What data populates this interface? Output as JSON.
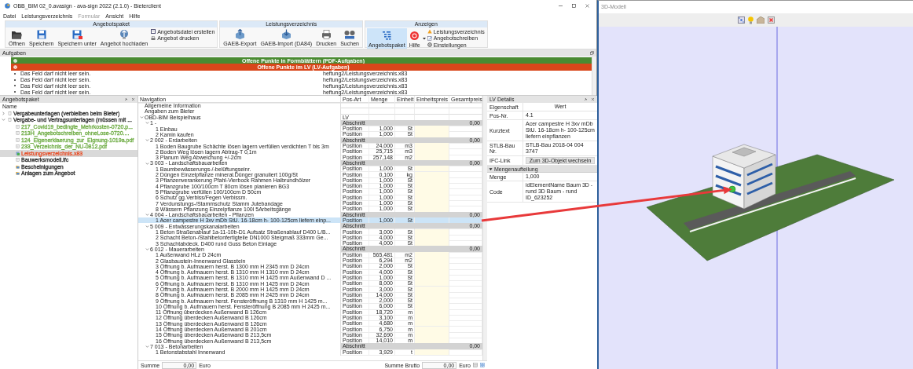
{
  "window": {
    "title": "OBB_BIM 02_0.avasign - ava-sign 2022 (2.1.0) - Bieterclient"
  },
  "menu": [
    {
      "label": "Datei",
      "disabled": false
    },
    {
      "label": "Leistungsverzeichnis",
      "disabled": false
    },
    {
      "label": "Formular",
      "disabled": true
    },
    {
      "label": "Ansicht",
      "disabled": false
    },
    {
      "label": "Hilfe",
      "disabled": false
    }
  ],
  "ribbon": [
    {
      "title": "Angebotspaket",
      "buttons": [
        {
          "label": "Öffnen",
          "kind": "large",
          "selected": false
        },
        {
          "label": "Speichern",
          "kind": "large",
          "selected": false
        },
        {
          "label": "Speichern unter",
          "kind": "large",
          "selected": false
        },
        {
          "label": "Angebot hochladen",
          "kind": "large",
          "selected": false
        },
        {
          "label": "Angebotsdatei erstellen",
          "kind": "small",
          "selected": false
        },
        {
          "label": "Angebot drucken",
          "kind": "small",
          "selected": false
        }
      ]
    },
    {
      "title": "Leistungsverzeichnis",
      "buttons": [
        {
          "label": "GAEB-Export",
          "kind": "large",
          "selected": false
        },
        {
          "label": "GAEB-Import (DA84)",
          "kind": "large",
          "selected": false
        },
        {
          "label": "Drucken",
          "kind": "large",
          "selected": false
        },
        {
          "label": "Suchen",
          "kind": "large",
          "selected": false
        }
      ]
    },
    {
      "title": "Anzeigen",
      "buttons": [
        {
          "label": "Angebotspaket",
          "kind": "large",
          "selected": true
        },
        {
          "label": "Hilfe",
          "kind": "large",
          "selected": false
        },
        {
          "label": "Leistungsverzeichnis",
          "kind": "small",
          "selected": false
        },
        {
          "label": "Angebotschreiben",
          "kind": "small",
          "selected": false
        },
        {
          "label": "Einstellungen",
          "kind": "small",
          "selected": false
        }
      ]
    }
  ],
  "tasks": {
    "title": "Aufgaben",
    "groups": [
      {
        "label": "Offene Punkte in Formblättern (PDF-Aufgaben)",
        "kind": "ok"
      },
      {
        "label": "Offene Punkte im LV (LV-Aufgaben)",
        "kind": "error"
      }
    ],
    "rows": [
      {
        "message": "Das Feld darf nicht leer sein.",
        "file": "heftung2/Leistungsverzeichnis.x83"
      },
      {
        "message": "Das Feld darf nicht leer sein.",
        "file": "heftung2/Leistungsverzeichnis.x83"
      },
      {
        "message": "Das Feld darf nicht leer sein.",
        "file": "heftung2/Leistungsverzeichnis.x83"
      },
      {
        "message": "Das Feld darf nicht leer sein.",
        "file": "heftung2/Leistungsverzeichnis.x83"
      }
    ]
  },
  "package": {
    "title": "Angebotspaket",
    "column": "Name",
    "items": [
      {
        "label": "Vergabeunterlagen (verbleiben beim Bieter)",
        "kind": "group",
        "color": "#333333",
        "selected": false,
        "expanded": false
      },
      {
        "label": "Vergabe- und Vertragsunterlagen (müssen mit ...",
        "kind": "group",
        "color": "#333333",
        "selected": false,
        "expanded": true,
        "children": [
          {
            "label": "217_Covid19_bedingte_Mehrkosten-0720.p...",
            "kind": "file",
            "color": "#70ad47",
            "selected": false
          },
          {
            "label": "213H_Angebotschreiben_ohneLose-0720....",
            "kind": "file",
            "color": "#70ad47",
            "selected": false
          },
          {
            "label": "124_Eigenerklaerung_zur_Eignung-1019a.pdf",
            "kind": "file",
            "color": "#70ad47",
            "selected": false
          },
          {
            "label": "233_Verzeichnis_der_NU-0812.pdf",
            "kind": "file",
            "color": "#70ad47",
            "selected": false
          },
          {
            "label": "Leistungsverzeichnis.x83",
            "kind": "lv",
            "color": "#e8502a",
            "selected": true
          },
          {
            "label": "Bauwerksmodell.ifc",
            "kind": "file",
            "color": "#333333",
            "selected": false
          },
          {
            "label": "Bescheinigungen",
            "kind": "folder",
            "color": "#333333",
            "selected": false
          },
          {
            "label": "Anlagen zum Angebot",
            "kind": "folder",
            "color": "#333333",
            "selected": false
          }
        ]
      }
    ]
  },
  "table": {
    "columns": [
      "Navigation",
      "Pos-Art",
      "Menge",
      "Einheit",
      "Einheitspreis",
      "Gesamtpreis"
    ],
    "rows": [
      {
        "label": "Allgemeine Information",
        "kind": "info",
        "selected": false
      },
      {
        "label": "Angaben zum Bieter",
        "kind": "info",
        "selected": false
      },
      {
        "label": "OBD-BIM Beispielhaus",
        "kind": "lv",
        "pos_art": "LV",
        "selected": false,
        "expanded": true,
        "children": [
          {
            "label": "1 -",
            "kind": "section",
            "pos_art": "Abschnitt",
            "total": "0,00",
            "selected": false,
            "expanded": true,
            "children": [
              {
                "label": "1 Einbau",
                "kind": "position",
                "pos_art": "Position",
                "menge": "1,000",
                "einheit": "St",
                "selected": false
              },
              {
                "label": "2 Kamin kaufen",
                "kind": "position",
                "pos_art": "Position",
                "menge": "1,000",
                "einheit": "St",
                "selected": false
              }
            ]
          },
          {
            "label": "2 002 - Erdarbeiten",
            "kind": "section",
            "pos_art": "Abschnitt",
            "total": "0,00",
            "selected": false,
            "expanded": true,
            "children": [
              {
                "label": "1 Boden Baugrube Schächte lösen lagern verfüllen verdichten T bis 3m",
                "kind": "position",
                "pos_art": "Position",
                "menge": "24,000",
                "einheit": "m3",
                "selected": false
              },
              {
                "label": "2 Boden Weg lösen lagern Abtrag-T 0,1m",
                "kind": "position",
                "pos_art": "Position",
                "menge": "25,715",
                "einheit": "m3",
                "selected": false
              },
              {
                "label": "3 Planum Weg Abweichung +/-2cm",
                "kind": "position",
                "pos_art": "Position",
                "menge": "257,148",
                "einheit": "m2",
                "selected": false
              }
            ]
          },
          {
            "label": "3 003 - Landschaftsbauarbeiten",
            "kind": "section",
            "pos_art": "Abschnitt",
            "total": "0,00",
            "selected": false,
            "expanded": true,
            "children": [
              {
                "label": "1 Baumbewässerungs-/-belüftungseinr.",
                "kind": "position",
                "pos_art": "Position",
                "menge": "1,000",
                "einheit": "St",
                "selected": false
              },
              {
                "label": "2 Düngen Einzelpflanze mineral.Dünger granuliert 100g/St",
                "kind": "position",
                "pos_art": "Position",
                "menge": "0,100",
                "einheit": "kg",
                "selected": false
              },
              {
                "label": "3 Pflanzenverankerung Pfahl-Vierbock Rahmen Halbrundhölzer",
                "kind": "position",
                "pos_art": "Position",
                "menge": "1,000",
                "einheit": "St",
                "selected": false
              },
              {
                "label": "4 Pflanzgrube 100/100cm T 80cm lösen planieren BG3",
                "kind": "position",
                "pos_art": "Position",
                "menge": "1,000",
                "einheit": "St",
                "selected": false
              },
              {
                "label": "5 Pflanzgrube verfüllen 100/100cm D 50cm",
                "kind": "position",
                "pos_art": "Position",
                "menge": "1,000",
                "einheit": "St",
                "selected": false
              },
              {
                "label": "6 Schutz gg.Verbiss/Fegen Verbissm.",
                "kind": "position",
                "pos_art": "Position",
                "menge": "1,000",
                "einheit": "St",
                "selected": false
              },
              {
                "label": "7 Verdunstungs-/Stammschutz Stamm Jutebandage",
                "kind": "position",
                "pos_art": "Position",
                "menge": "1,000",
                "einheit": "St",
                "selected": false
              },
              {
                "label": "8 Wässern Pflanzung Einzelpflanze 100l 5Arbeitsgänge",
                "kind": "position",
                "pos_art": "Position",
                "menge": "1,000",
                "einheit": "St",
                "selected": false
              }
            ]
          },
          {
            "label": "4 004 - Landschaftsbauarbeiten - Pflanzen",
            "kind": "section",
            "pos_art": "Abschnitt",
            "total": "0,00",
            "selected": false,
            "expanded": true,
            "children": [
              {
                "label": "1 Acer campestre H 3xv mDb StU. 16-18cm h- 100-125cm liefern einp...",
                "kind": "position",
                "pos_art": "Position",
                "menge": "1,000",
                "einheit": "St",
                "selected": true
              }
            ]
          },
          {
            "label": "5 009 - Entwässerungskanalarbeiten",
            "kind": "section",
            "pos_art": "Abschnitt",
            "total": "0,00",
            "selected": false,
            "expanded": true,
            "children": [
              {
                "label": "1 Beton Straßenablauf 1a-11-10b-D1 Aufsatz Straßenablauf D400 L/B...",
                "kind": "position",
                "pos_art": "Position",
                "menge": "3,000",
                "einheit": "St",
                "selected": false
              },
              {
                "label": "2 Schacht Beton-/Stahlbetonfertigteile DN1000 Steigmaß 333mm Ge...",
                "kind": "position",
                "pos_art": "Position",
                "menge": "4,000",
                "einheit": "St",
                "selected": false
              },
              {
                "label": "3 Schachtabdeck. D400 rund Guss Beton Einlage",
                "kind": "position",
                "pos_art": "Position",
                "menge": "4,000",
                "einheit": "St",
                "selected": false
              }
            ]
          },
          {
            "label": "6 012 - Mauerarbeiten",
            "kind": "section",
            "pos_art": "Abschnitt",
            "total": "0,00",
            "selected": false,
            "expanded": true,
            "children": [
              {
                "label": "1 Außenwand HLz D 24cm",
                "kind": "position",
                "pos_art": "Position",
                "menge": "565,481",
                "einheit": "m2",
                "selected": false
              },
              {
                "label": "2 Glasbaustein-Innenwand Glasstein",
                "kind": "position",
                "pos_art": "Position",
                "menge": "6,294",
                "einheit": "m2",
                "selected": false
              },
              {
                "label": "3 Öffnung b. Aufmauern herst. B 1300 mm H 2345 mm D 24cm",
                "kind": "position",
                "pos_art": "Position",
                "menge": "2,000",
                "einheit": "St",
                "selected": false
              },
              {
                "label": "4 Öffnung b. Aufmauern herst. B 1310 mm H 1310 mm D 24cm",
                "kind": "position",
                "pos_art": "Position",
                "menge": "4,000",
                "einheit": "St",
                "selected": false
              },
              {
                "label": "5 Öffnung b. Aufmauern herst. B 1310 mm H 1425 mm Außenwand D ...",
                "kind": "position",
                "pos_art": "Position",
                "menge": "1,000",
                "einheit": "St",
                "selected": false
              },
              {
                "label": "6 Öffnung b. Aufmauern herst. B 1310 mm H 1425 mm D 24cm",
                "kind": "position",
                "pos_art": "Position",
                "menge": "8,000",
                "einheit": "St",
                "selected": false
              },
              {
                "label": "7 Öffnung b. Aufmauern herst. B 2000 mm H 1425 mm D 24cm",
                "kind": "position",
                "pos_art": "Position",
                "menge": "3,000",
                "einheit": "St",
                "selected": false
              },
              {
                "label": "8 Öffnung b. Aufmauern herst. B 2085 mm H 2425 mm D 24cm",
                "kind": "position",
                "pos_art": "Position",
                "menge": "14,000",
                "einheit": "St",
                "selected": false
              },
              {
                "label": "9 Öffnung b. Aufmauern herst. Fensteröffnung B 1310 mm H 1425 m...",
                "kind": "position",
                "pos_art": "Position",
                "menge": "2,000",
                "einheit": "St",
                "selected": false
              },
              {
                "label": "10 Öffnung b. Aufmauern herst. Fensteröffnung B 2085 mm H 2425 m...",
                "kind": "position",
                "pos_art": "Position",
                "menge": "6,000",
                "einheit": "St",
                "selected": false
              },
              {
                "label": "11 Öffnung überdecken Außenwand B 126cm",
                "kind": "position",
                "pos_art": "Position",
                "menge": "18,720",
                "einheit": "m",
                "selected": false
              },
              {
                "label": "12 Öffnung überdecken Außenwand B 126cm",
                "kind": "position",
                "pos_art": "Position",
                "menge": "3,100",
                "einheit": "m",
                "selected": false
              },
              {
                "label": "13 Öffnung überdecken Außenwand B 126cm",
                "kind": "position",
                "pos_art": "Position",
                "menge": "4,680",
                "einheit": "m",
                "selected": false
              },
              {
                "label": "14 Öffnung überdecken Außenwand B 201cm",
                "kind": "position",
                "pos_art": "Position",
                "menge": "6,750",
                "einheit": "m",
                "selected": false
              },
              {
                "label": "15 Öffnung überdecken Außenwand B 213,5cm",
                "kind": "position",
                "pos_art": "Position",
                "menge": "32,690",
                "einheit": "m",
                "selected": false
              },
              {
                "label": "16 Öffnung überdecken Außenwand B 213,5cm",
                "kind": "position",
                "pos_art": "Position",
                "menge": "14,010",
                "einheit": "m",
                "selected": false
              }
            ]
          },
          {
            "label": "7 013 - Betonarbeiten",
            "kind": "section",
            "pos_art": "Abschnitt",
            "total": "0,00",
            "selected": false,
            "expanded": true,
            "children": [
              {
                "label": "1 Betonstabstahl Innenwand",
                "kind": "position",
                "pos_art": "Position",
                "menge": "3,929",
                "einheit": "t",
                "selected": false
              }
            ]
          }
        ]
      }
    ]
  },
  "totals": {
    "sum_label": "Summe",
    "sum": "0,00",
    "sum_currency": "Euro",
    "gross_label": "Summe Brutto",
    "gross": "0,00",
    "gross_currency": "Euro"
  },
  "details": {
    "title": "LV Details",
    "columns": [
      "Eigenschaft",
      "Wert"
    ],
    "rows": [
      {
        "label": "Pos-Nr.",
        "value": "4.1",
        "kind": "text"
      },
      {
        "label": "Kurztext",
        "value": "Acer campestre H 3xv mDb StU. 16-18cm h- 100-125cm liefern einpflanzen",
        "kind": "text"
      },
      {
        "label": "STLB-Bau Nr.",
        "value": "STLB-Bau 2018-04 004 3747",
        "kind": "text"
      },
      {
        "label": "IFC-Link",
        "value": "Zum 3D-Objekt wechseln",
        "kind": "button"
      }
    ],
    "section": {
      "label": "Mengenaufteilung",
      "expanded": true,
      "rows": [
        {
          "label": "Menge",
          "value": "1,000",
          "kind": "text"
        },
        {
          "label": "Code",
          "value": "idElementName Baum 3D - rund 3D Baum - rund ID_623252",
          "kind": "text"
        }
      ]
    }
  },
  "model": {
    "title": "3D-Modell"
  }
}
